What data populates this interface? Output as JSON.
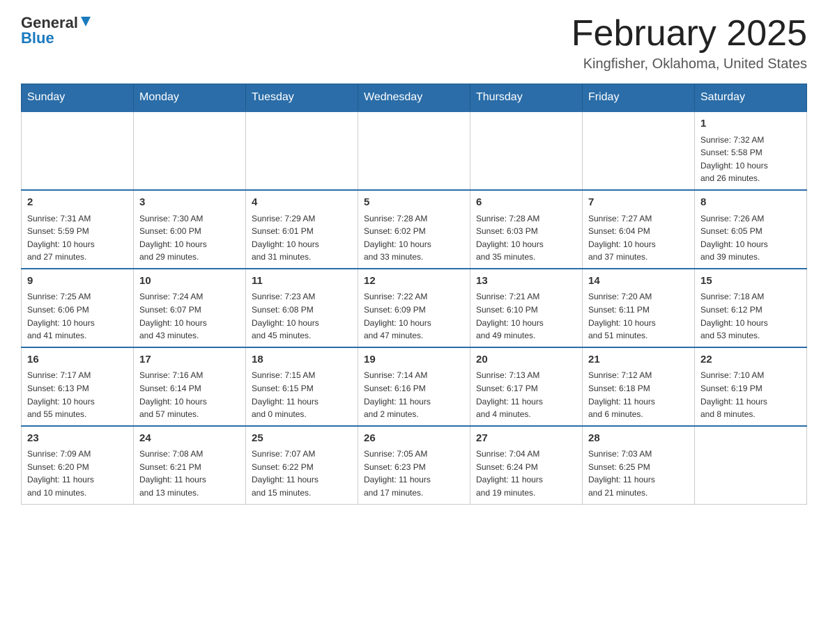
{
  "header": {
    "logo_general": "General",
    "logo_blue": "Blue",
    "main_title": "February 2025",
    "subtitle": "Kingfisher, Oklahoma, United States"
  },
  "days_of_week": [
    "Sunday",
    "Monday",
    "Tuesday",
    "Wednesday",
    "Thursday",
    "Friday",
    "Saturday"
  ],
  "weeks": [
    [
      {
        "day": "",
        "info": ""
      },
      {
        "day": "",
        "info": ""
      },
      {
        "day": "",
        "info": ""
      },
      {
        "day": "",
        "info": ""
      },
      {
        "day": "",
        "info": ""
      },
      {
        "day": "",
        "info": ""
      },
      {
        "day": "1",
        "info": "Sunrise: 7:32 AM\nSunset: 5:58 PM\nDaylight: 10 hours\nand 26 minutes."
      }
    ],
    [
      {
        "day": "2",
        "info": "Sunrise: 7:31 AM\nSunset: 5:59 PM\nDaylight: 10 hours\nand 27 minutes."
      },
      {
        "day": "3",
        "info": "Sunrise: 7:30 AM\nSunset: 6:00 PM\nDaylight: 10 hours\nand 29 minutes."
      },
      {
        "day": "4",
        "info": "Sunrise: 7:29 AM\nSunset: 6:01 PM\nDaylight: 10 hours\nand 31 minutes."
      },
      {
        "day": "5",
        "info": "Sunrise: 7:28 AM\nSunset: 6:02 PM\nDaylight: 10 hours\nand 33 minutes."
      },
      {
        "day": "6",
        "info": "Sunrise: 7:28 AM\nSunset: 6:03 PM\nDaylight: 10 hours\nand 35 minutes."
      },
      {
        "day": "7",
        "info": "Sunrise: 7:27 AM\nSunset: 6:04 PM\nDaylight: 10 hours\nand 37 minutes."
      },
      {
        "day": "8",
        "info": "Sunrise: 7:26 AM\nSunset: 6:05 PM\nDaylight: 10 hours\nand 39 minutes."
      }
    ],
    [
      {
        "day": "9",
        "info": "Sunrise: 7:25 AM\nSunset: 6:06 PM\nDaylight: 10 hours\nand 41 minutes."
      },
      {
        "day": "10",
        "info": "Sunrise: 7:24 AM\nSunset: 6:07 PM\nDaylight: 10 hours\nand 43 minutes."
      },
      {
        "day": "11",
        "info": "Sunrise: 7:23 AM\nSunset: 6:08 PM\nDaylight: 10 hours\nand 45 minutes."
      },
      {
        "day": "12",
        "info": "Sunrise: 7:22 AM\nSunset: 6:09 PM\nDaylight: 10 hours\nand 47 minutes."
      },
      {
        "day": "13",
        "info": "Sunrise: 7:21 AM\nSunset: 6:10 PM\nDaylight: 10 hours\nand 49 minutes."
      },
      {
        "day": "14",
        "info": "Sunrise: 7:20 AM\nSunset: 6:11 PM\nDaylight: 10 hours\nand 51 minutes."
      },
      {
        "day": "15",
        "info": "Sunrise: 7:18 AM\nSunset: 6:12 PM\nDaylight: 10 hours\nand 53 minutes."
      }
    ],
    [
      {
        "day": "16",
        "info": "Sunrise: 7:17 AM\nSunset: 6:13 PM\nDaylight: 10 hours\nand 55 minutes."
      },
      {
        "day": "17",
        "info": "Sunrise: 7:16 AM\nSunset: 6:14 PM\nDaylight: 10 hours\nand 57 minutes."
      },
      {
        "day": "18",
        "info": "Sunrise: 7:15 AM\nSunset: 6:15 PM\nDaylight: 11 hours\nand 0 minutes."
      },
      {
        "day": "19",
        "info": "Sunrise: 7:14 AM\nSunset: 6:16 PM\nDaylight: 11 hours\nand 2 minutes."
      },
      {
        "day": "20",
        "info": "Sunrise: 7:13 AM\nSunset: 6:17 PM\nDaylight: 11 hours\nand 4 minutes."
      },
      {
        "day": "21",
        "info": "Sunrise: 7:12 AM\nSunset: 6:18 PM\nDaylight: 11 hours\nand 6 minutes."
      },
      {
        "day": "22",
        "info": "Sunrise: 7:10 AM\nSunset: 6:19 PM\nDaylight: 11 hours\nand 8 minutes."
      }
    ],
    [
      {
        "day": "23",
        "info": "Sunrise: 7:09 AM\nSunset: 6:20 PM\nDaylight: 11 hours\nand 10 minutes."
      },
      {
        "day": "24",
        "info": "Sunrise: 7:08 AM\nSunset: 6:21 PM\nDaylight: 11 hours\nand 13 minutes."
      },
      {
        "day": "25",
        "info": "Sunrise: 7:07 AM\nSunset: 6:22 PM\nDaylight: 11 hours\nand 15 minutes."
      },
      {
        "day": "26",
        "info": "Sunrise: 7:05 AM\nSunset: 6:23 PM\nDaylight: 11 hours\nand 17 minutes."
      },
      {
        "day": "27",
        "info": "Sunrise: 7:04 AM\nSunset: 6:24 PM\nDaylight: 11 hours\nand 19 minutes."
      },
      {
        "day": "28",
        "info": "Sunrise: 7:03 AM\nSunset: 6:25 PM\nDaylight: 11 hours\nand 21 minutes."
      },
      {
        "day": "",
        "info": ""
      }
    ]
  ]
}
